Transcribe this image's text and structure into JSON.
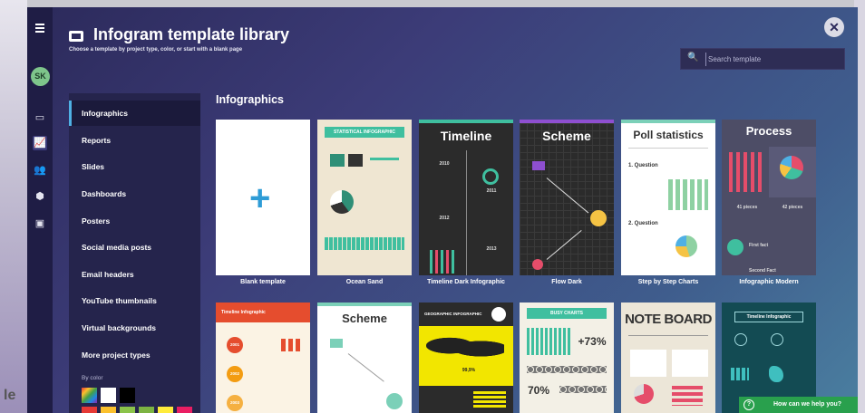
{
  "header": {
    "title": "Infogram template library",
    "subtitle": "Choose a template by project type, color, or start with a blank page"
  },
  "user": {
    "initials": "SK"
  },
  "search": {
    "placeholder": "Search template"
  },
  "sidebar": {
    "items": [
      {
        "label": "Infographics"
      },
      {
        "label": "Reports"
      },
      {
        "label": "Slides"
      },
      {
        "label": "Dashboards"
      },
      {
        "label": "Posters"
      },
      {
        "label": "Social media posts"
      },
      {
        "label": "Email headers"
      },
      {
        "label": "YouTube thumbnails"
      },
      {
        "label": "Virtual backgrounds"
      },
      {
        "label": "More project types"
      }
    ],
    "by_color_label": "By color",
    "colors": [
      "#ffffff",
      "#000000",
      "#e53935",
      "#fbc02d",
      "#8bc34a",
      "#7cb342",
      "#ffeb3b",
      "#e91e63"
    ]
  },
  "section": {
    "title": "Infographics"
  },
  "templates_row1": [
    {
      "label": "Blank template"
    },
    {
      "label": "Ocean Sand",
      "heading": "STATISTICAL INFOGRAPHIC"
    },
    {
      "label": "Timeline Dark Infographic",
      "heading": "Timeline",
      "years": [
        "2010",
        "2011",
        "2012",
        "2013"
      ]
    },
    {
      "label": "Flow Dark",
      "heading": "Scheme"
    },
    {
      "label": "Step by Step Charts",
      "heading": "Poll statistics",
      "q1": "1. Question",
      "q2": "2. Question"
    },
    {
      "label": "Infographic Modern",
      "heading": "Process",
      "p1": "41 pieces",
      "p2": "42 pieces",
      "f1": "First fact",
      "f2": "Second Fact"
    }
  ],
  "templates_row2": [
    {
      "heading": "Timeline Infographic",
      "years": [
        "2001",
        "2002",
        "2003"
      ]
    },
    {
      "heading": "Scheme"
    },
    {
      "heading": "GEOGRAPHIC INFOGRAPHIC",
      "stat": "99,9%"
    },
    {
      "heading": "BUSY CHARTS",
      "stat1": "+73%",
      "stat2": "70%"
    },
    {
      "heading": "NOTE BOARD"
    },
    {
      "heading": "Timeline Infographic"
    }
  ],
  "help": {
    "label": "How can we help you?"
  },
  "colors": {
    "accent": "#4fb0e4",
    "help_green": "#29a04d",
    "modal_dark": "#2c2a5b"
  }
}
